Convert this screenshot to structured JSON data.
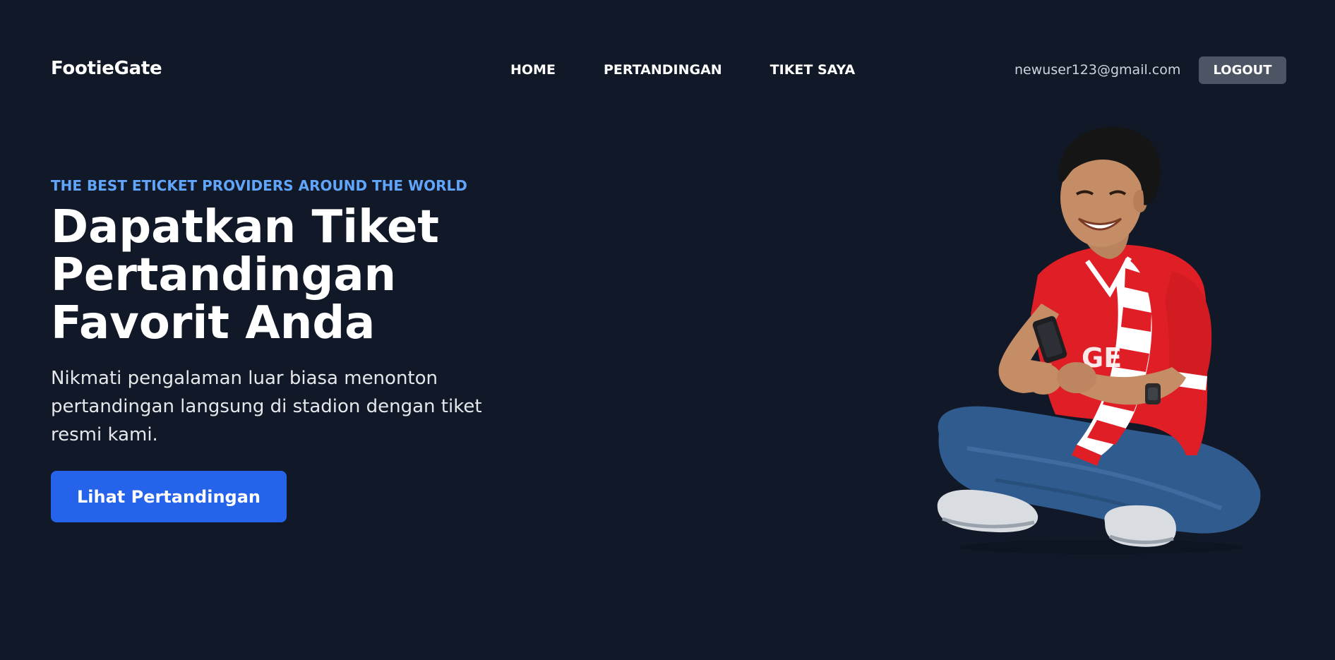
{
  "navbar": {
    "brand": "FootieGate",
    "links": [
      {
        "label": "HOME"
      },
      {
        "label": "PERTANDINGAN"
      },
      {
        "label": "TIKET SAYA"
      }
    ],
    "user_email": "newuser123@gmail.com",
    "logout_label": "LOGOUT"
  },
  "hero": {
    "eyebrow": "THE BEST ETICKET PROVIDERS AROUND THE WORLD",
    "title": "Dapatkan Tiket Pertandingan Favorit Anda",
    "description": "Nikmati pengalaman luar biasa menonton pertandingan langsung di stadion dengan tiket resmi kami.",
    "cta_label": "Lihat Pertandingan",
    "image_icon": "football-fan-with-phone-illustration"
  },
  "colors": {
    "background": "#111827",
    "accent": "#2563eb",
    "eyebrow": "#60a5fa",
    "logout_bg": "#4b5563"
  }
}
